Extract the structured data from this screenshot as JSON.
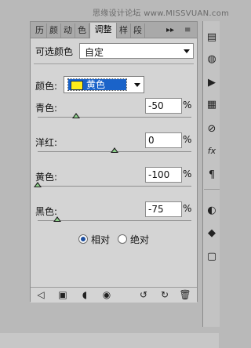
{
  "watermark": "思缘设计论坛 www.MISSVUAN.com",
  "tabs": [
    {
      "label": "历"
    },
    {
      "label": "颜"
    },
    {
      "label": "动"
    },
    {
      "label": "色"
    },
    {
      "label": "调整"
    },
    {
      "label": "样"
    },
    {
      "label": "段"
    }
  ],
  "tab_more": "▸▸",
  "menu_icon": "≡",
  "header": {
    "title": "可选颜色",
    "preset_value": "自定"
  },
  "color_select": {
    "label": "颜色:",
    "value": "黄色",
    "swatch_color": "#ffec1a"
  },
  "sliders": [
    {
      "label": "青色:",
      "value": "-50",
      "pct": "%",
      "level": -50
    },
    {
      "label": "洋红:",
      "value": "0",
      "pct": "%",
      "level": 0
    },
    {
      "label": "黄色:",
      "value": "-100",
      "pct": "%",
      "level": -100
    },
    {
      "label": "黑色:",
      "value": "-75",
      "pct": "%",
      "level": -75
    }
  ],
  "mode": {
    "relative_label": "相对",
    "absolute_label": "绝对",
    "selected": "relative"
  },
  "footer_icons": [
    "back-arrow-icon",
    "layer-clip-icon",
    "mask-icon",
    "visibility-eye-icon",
    "previous-state-icon",
    "reset-icon",
    "trash-icon"
  ],
  "right_panel_icons": [
    "layers-icon",
    "palette-icon",
    "play-icon",
    "grid-icon",
    "brush-icon",
    "fx-icon",
    "paragraph-icon",
    "sphere-icon",
    "stack-icon",
    "square-icon"
  ]
}
